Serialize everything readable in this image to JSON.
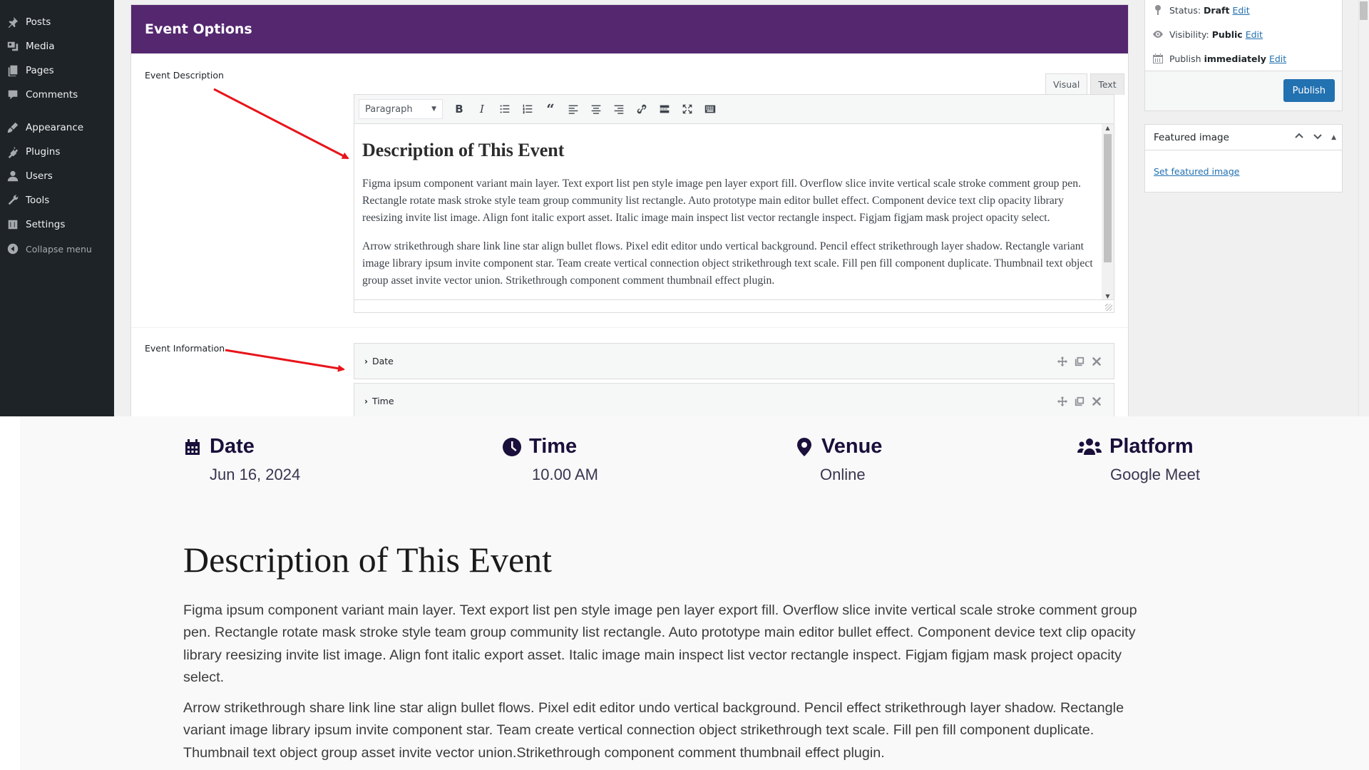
{
  "admin_menu": {
    "items": [
      {
        "label": "Posts",
        "icon": "pushpin-icon"
      },
      {
        "label": "Media",
        "icon": "media-icon"
      },
      {
        "label": "Pages",
        "icon": "pages-icon"
      },
      {
        "label": "Comments",
        "icon": "comment-icon"
      },
      {
        "label": "Appearance",
        "icon": "paintbrush-icon"
      },
      {
        "label": "Plugins",
        "icon": "plugin-icon"
      },
      {
        "label": "Users",
        "icon": "user-icon"
      },
      {
        "label": "Tools",
        "icon": "wrench-icon"
      },
      {
        "label": "Settings",
        "icon": "settings-icon"
      }
    ],
    "collapse_label": "Collapse menu"
  },
  "event_options": {
    "title": "Event Options",
    "accent_color": "#54276f",
    "description_label": "Event Description",
    "information_label": "Event Information",
    "editor": {
      "tabs": [
        "Visual",
        "Text"
      ],
      "format_select": "Paragraph",
      "toolbar_buttons": [
        "bold",
        "italic",
        "bulleted-list",
        "numbered-list",
        "blockquote",
        "align-left",
        "align-center",
        "align-right",
        "insert-link",
        "read-more",
        "fullscreen",
        "toolbar-toggle"
      ],
      "heading": "Description of This Event",
      "paragraphs": [
        "Figma ipsum component variant main layer. Text export list pen style image pen layer export fill. Overflow slice invite vertical scale stroke comment group pen. Rectangle rotate mask stroke style team group community list rectangle. Auto prototype main editor bullet effect. Component device text clip opacity library reesizing invite list image. Align font italic export asset. Italic image main inspect list vector rectangle inspect. Figjam figjam mask project opacity select.",
        "Arrow strikethrough share link line star align bullet flows. Pixel edit editor undo vertical background. Pencil effect strikethrough layer shadow. Rectangle variant image library ipsum invite component star. Team create vertical connection object strikethrough text scale. Fill pen fill component duplicate. Thumbnail text object group asset invite vector union. Strikethrough component comment thumbnail effect plugin."
      ]
    },
    "repeaters": [
      {
        "label": "Date"
      },
      {
        "label": "Time"
      }
    ]
  },
  "publish_box": {
    "status_label": "Status:",
    "status_value": "Draft",
    "visibility_label": "Visibility:",
    "visibility_value": "Public",
    "publish_label": "Publish",
    "publish_value": "immediately",
    "edit_link": "Edit",
    "publish_button": "Publish",
    "button_color": "#2271b1"
  },
  "featured_image": {
    "title": "Featured image",
    "link": "Set featured image"
  },
  "preview": {
    "info": [
      {
        "title": "Date",
        "value": "Jun 16, 2024",
        "icon": "calendar-icon"
      },
      {
        "title": "Time",
        "value": "10.00 AM",
        "icon": "clock-icon"
      },
      {
        "title": "Venue",
        "value": "Online",
        "icon": "map-pin-icon"
      },
      {
        "title": "Platform",
        "value": "Google Meet",
        "icon": "users-icon"
      }
    ],
    "heading": "Description of This Event",
    "paragraphs": [
      "Figma ipsum component variant main layer. Text export list pen style image pen layer export fill. Overflow slice invite vertical scale stroke comment group pen. Rectangle rotate mask stroke style team group community list rectangle. Auto prototype main editor bullet effect. Component device text clip opacity library reesizing invite list image. Align font italic export asset. Italic image main inspect list vector rectangle inspect. Figjam figjam mask project opacity select.",
      "Arrow strikethrough share link line star align bullet flows. Pixel edit editor undo vertical background. Pencil effect strikethrough layer shadow. Rectangle variant image library ipsum invite component star. Team create vertical connection object strikethrough text scale. Fill pen fill component duplicate. Thumbnail text object group asset invite vector union.Strikethrough component comment thumbnail effect plugin."
    ],
    "text_color": "#1b0f3b"
  }
}
